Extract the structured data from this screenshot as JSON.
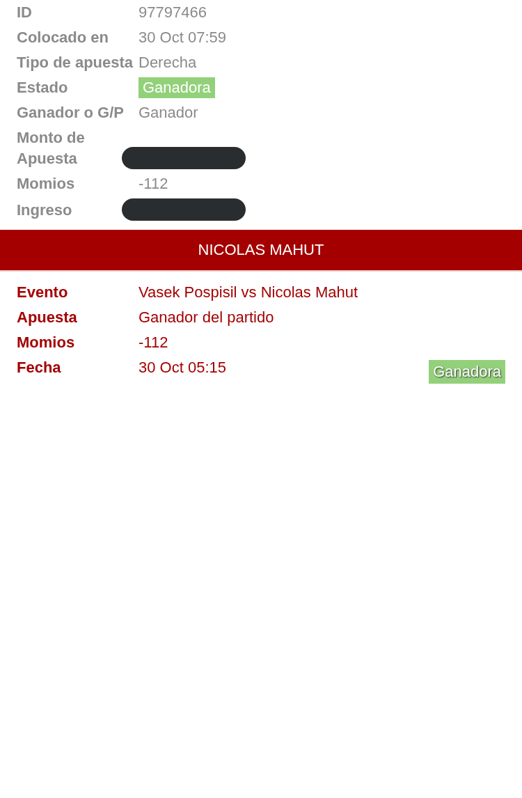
{
  "bet_details": [
    {
      "label": "ID",
      "kind": "text",
      "value": "97797466"
    },
    {
      "label": "Colocado en",
      "kind": "text",
      "value": "30 Oct 07:59"
    },
    {
      "label": "Tipo de apuesta",
      "kind": "text",
      "value": "Derecha"
    },
    {
      "label": "Estado",
      "kind": "badge",
      "value": "Ganadora"
    },
    {
      "label": "Ganador o G/P",
      "kind": "text",
      "value": "Ganador"
    },
    {
      "label": "Monto de Apuesta",
      "kind": "redacted"
    },
    {
      "label": "Momios",
      "kind": "text",
      "value": "-112"
    },
    {
      "label": "Ingreso",
      "kind": "redacted"
    }
  ],
  "selection": {
    "title": "NICOLAS MAHUT",
    "rows": [
      {
        "label": "Evento",
        "value": "Vasek Pospisil vs Nicolas Mahut"
      },
      {
        "label": "Apuesta",
        "value": "Ganador del partido"
      },
      {
        "label": "Momios",
        "value": "-112"
      },
      {
        "label": "Fecha",
        "value": "30 Oct 05:15"
      }
    ],
    "status": "Ganadora"
  }
}
